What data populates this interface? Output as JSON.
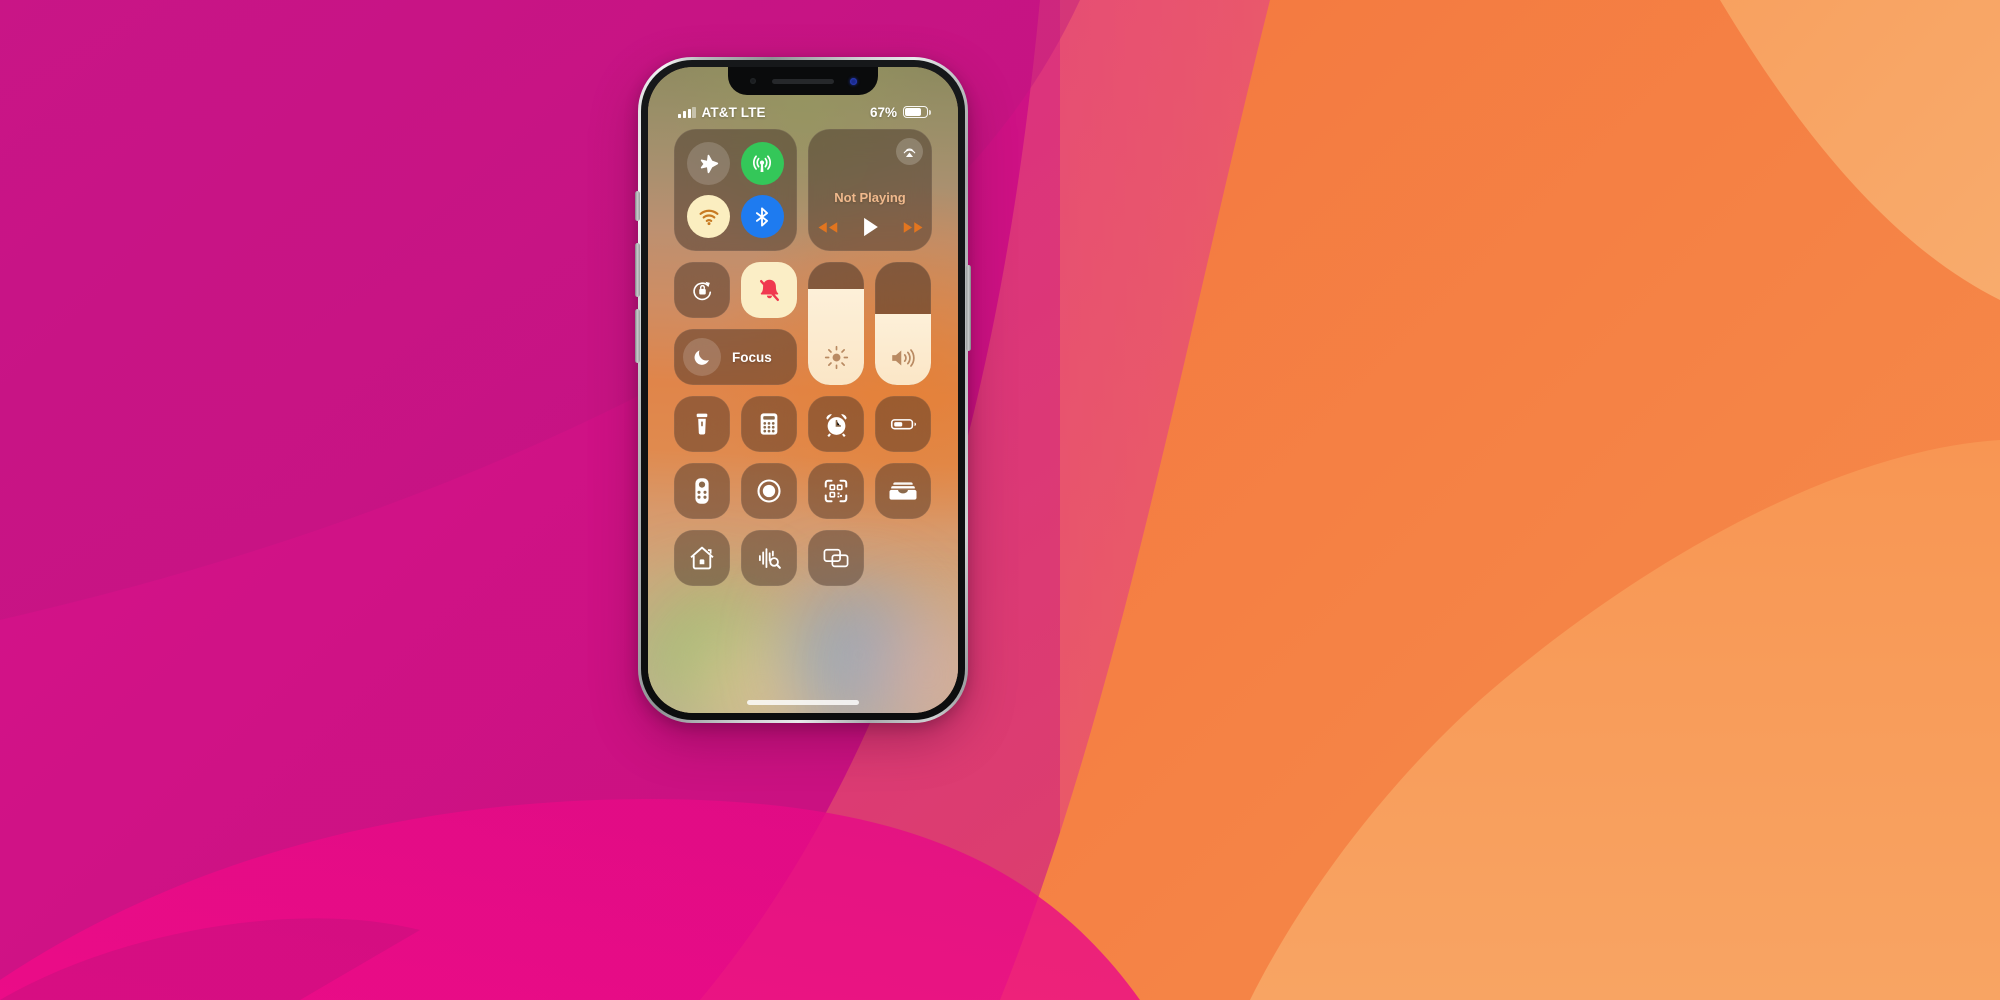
{
  "background": {
    "name": "abstract-wave-gradient",
    "magenta": "#D40F88",
    "magenta_dark": "#B1177E",
    "magenta_bright": "#ED0A86",
    "orange": "#F4783F",
    "orange_light": "#F79452",
    "orange_pale": "#F8A862",
    "salmon": "#EE6C5A"
  },
  "device": {
    "name": "iphone",
    "frame_color": "#c9cccd",
    "notch": {
      "speaker": "earpiece-speaker",
      "sensor": "proximity-sensor",
      "camera": "front-camera"
    },
    "home_indicator": "home-indicator"
  },
  "status_bar": {
    "carrier": "AT&T LTE",
    "signal_bars_total": 4,
    "signal_bars_filled": 3,
    "battery_percent_label": "67%",
    "battery_percent": 67
  },
  "control_center": {
    "connectivity": {
      "module_name": "connectivity-module",
      "toggles": [
        {
          "name": "airplane-mode",
          "icon": "airplane-icon",
          "state": "off",
          "color": "rgba(255,255,255,.17)"
        },
        {
          "name": "cellular-data",
          "icon": "cellular-icon",
          "state": "on",
          "color": "#34c759"
        },
        {
          "name": "wifi",
          "icon": "wifi-icon",
          "state": "on",
          "color": "#fbeec0"
        },
        {
          "name": "bluetooth",
          "icon": "bluetooth-icon",
          "state": "on",
          "color": "#1e7bf0"
        }
      ]
    },
    "media": {
      "module_name": "now-playing-module",
      "title": "Not Playing",
      "title_color": "#f0b98c",
      "airplay": {
        "name": "airplay-button",
        "icon": "airplay-icon"
      },
      "controls": [
        {
          "name": "rewind-button",
          "icon": "rewind-icon",
          "color": "#e2751f"
        },
        {
          "name": "play-button",
          "icon": "play-icon",
          "color": "#ffffff"
        },
        {
          "name": "fast-forward-button",
          "icon": "fast-forward-icon",
          "color": "#e2751f"
        }
      ]
    },
    "rotation_lock": {
      "name": "rotation-lock-toggle",
      "icon": "rotation-lock-icon",
      "state": "off"
    },
    "silent_mode": {
      "name": "silent-mode-toggle",
      "icon": "bell-slash-icon",
      "state": "on",
      "bg": "#fbeec6",
      "icon_color": "#f0384f"
    },
    "focus": {
      "name": "focus-button",
      "label": "Focus",
      "icon": "moon-icon",
      "state": "off"
    },
    "brightness": {
      "name": "brightness-slider",
      "icon": "brightness-icon",
      "value": 78
    },
    "volume": {
      "name": "volume-slider",
      "icon": "volume-icon",
      "value": 58
    },
    "utilities": [
      {
        "name": "flashlight-tile",
        "icon": "flashlight-icon"
      },
      {
        "name": "calculator-tile",
        "icon": "calculator-icon"
      },
      {
        "name": "timer-tile",
        "icon": "alarm-clock-icon"
      },
      {
        "name": "low-power-mode-tile",
        "icon": "battery-icon"
      },
      {
        "name": "apple-tv-remote-tile",
        "icon": "tv-remote-icon"
      },
      {
        "name": "screen-record-tile",
        "icon": "screen-record-icon"
      },
      {
        "name": "code-scanner-tile",
        "icon": "qr-scanner-icon"
      },
      {
        "name": "wallet-tile",
        "icon": "wallet-icon"
      },
      {
        "name": "home-tile",
        "icon": "home-icon"
      },
      {
        "name": "music-recognition-tile",
        "icon": "shazam-waveform-icon"
      },
      {
        "name": "screen-mirroring-tile",
        "icon": "screen-mirroring-icon"
      }
    ]
  }
}
